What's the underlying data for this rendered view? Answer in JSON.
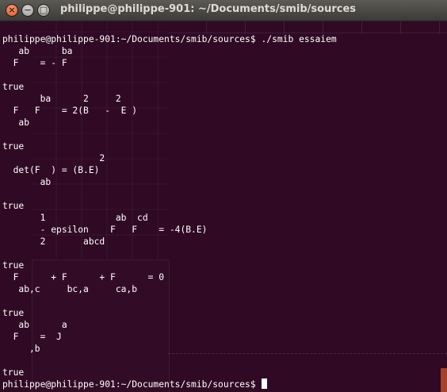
{
  "window": {
    "title": "philippe@philippe-901: ~/Documents/smib/sources",
    "close_glyph": "×",
    "minimize_glyph": "−",
    "maximize_glyph": "□"
  },
  "terminal": {
    "background": "#300a24",
    "foreground": "#ffffff",
    "lines": [
      "philippe@philippe-901:~/Documents/smib/sources$ ./smib essaiem",
      "   ab      ba",
      "  F    = - F",
      "",
      "true",
      "       ba      2     2",
      "  F   F    = 2(B   -  E )",
      "   ab",
      "",
      "true",
      "                  2",
      "  det(F  ) = (B.E)",
      "       ab",
      "",
      "true",
      "       1             ab  cd",
      "       - epsilon    F   F    = -4(B.E)",
      "       2       abcd",
      "",
      "true",
      "  F      + F      + F      = 0",
      "   ab,c     bc,a     ca,b",
      "",
      "true",
      "   ab      a",
      "  F    =  J",
      "     ,b",
      "",
      "true"
    ],
    "prompt": "philippe@philippe-901:~/Documents/smib/sources$ "
  }
}
